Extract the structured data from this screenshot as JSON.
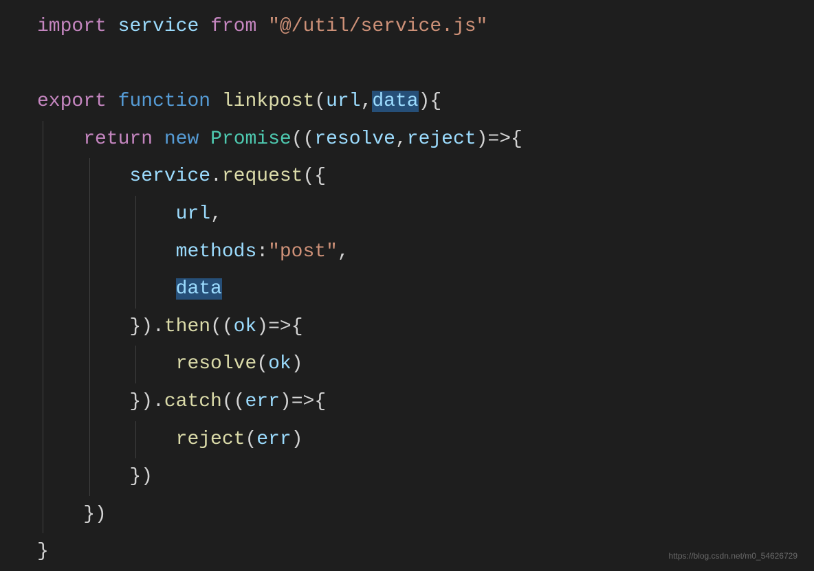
{
  "code": {
    "line1": {
      "import": "import",
      "service": "service",
      "from": "from",
      "path": "\"@/util/service.js\""
    },
    "line3": {
      "export": "export",
      "function": "function",
      "funcname": "linkpost",
      "param1": "url",
      "param2": "data"
    },
    "line4": {
      "return": "return",
      "new": "new",
      "promise": "Promise",
      "resolve": "resolve",
      "reject": "reject"
    },
    "line5": {
      "service": "service",
      "request": "request"
    },
    "line6": {
      "url": "url"
    },
    "line7": {
      "methods": "methods",
      "post": "\"post\""
    },
    "line8": {
      "data": "data"
    },
    "line9": {
      "then": "then",
      "ok": "ok"
    },
    "line10": {
      "resolve": "resolve",
      "ok": "ok"
    },
    "line11": {
      "catch": "catch",
      "err": "err"
    },
    "line12": {
      "reject": "reject",
      "err": "err"
    }
  },
  "watermark": "https://blog.csdn.net/m0_54626729"
}
